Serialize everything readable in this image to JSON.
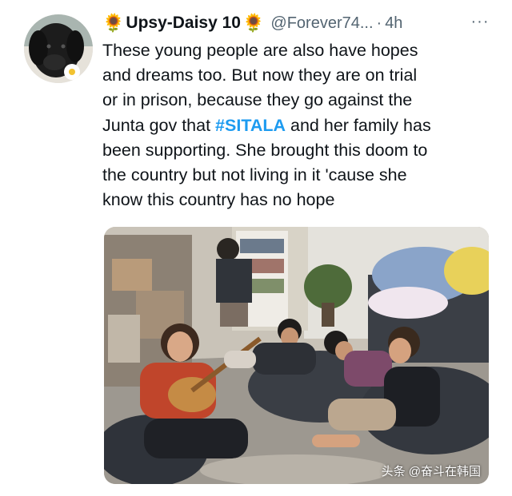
{
  "tweet": {
    "author": {
      "display_name": "Upsy-Daisy 10",
      "name_emoji": "🌻",
      "handle": "@Forever74...",
      "avatar_icon": "dog-avatar-icon"
    },
    "separator": "·",
    "time": "4h",
    "more_label": "···",
    "text_lines": [
      "These young people are also have hopes",
      "and dreams too. But now they are on trial",
      "or in prison, because they go against the"
    ],
    "line4_before": "Junta gov that ",
    "hashtag": "#SITALA",
    "line4_after": " and her family has",
    "text_lines_end": [
      "been supporting. She brought this doom to",
      "the country but not living in it 'cause she",
      "know this country has no hope"
    ],
    "hashtag_color": "#1d9bf0"
  },
  "watermark": "头条 @奋斗在韩国"
}
